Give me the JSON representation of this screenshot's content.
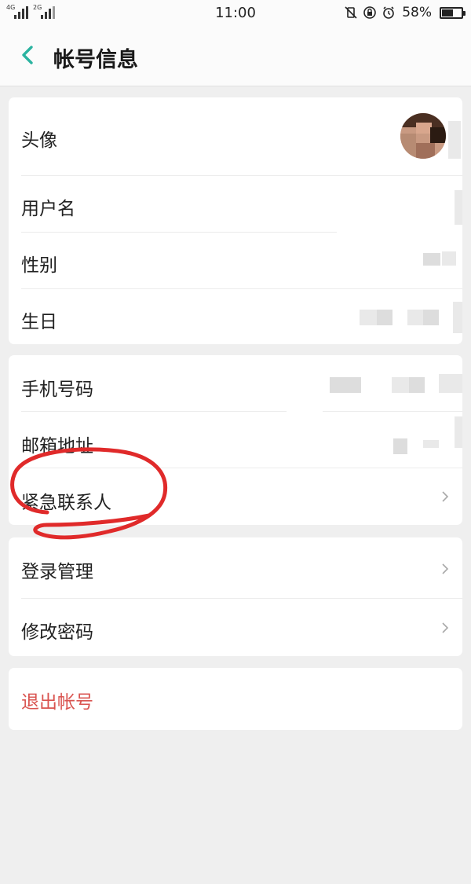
{
  "status_bar": {
    "network_1": "4G",
    "network_2": "2G",
    "time": "11:00",
    "battery_percent": "58%",
    "battery_level": 0.58,
    "icons": [
      "mute-vibrate-icon",
      "rotation-lock-icon",
      "alarm-icon",
      "battery-icon"
    ]
  },
  "header": {
    "title": "帐号信息",
    "back_icon": "chevron-left-icon",
    "accent_color": "#2bb3a0"
  },
  "profile_card": {
    "avatar_label": "头像",
    "username_label": "用户名",
    "gender_label": "性别",
    "birthday_label": "生日"
  },
  "contact_card": {
    "phone_label": "手机号码",
    "email_label": "邮箱地址",
    "emergency_label": "紧急联系人"
  },
  "security_card": {
    "login_label": "登录管理",
    "password_label": "修改密码"
  },
  "logout_card": {
    "logout_label": "退出帐号",
    "logout_color": "#d9534f"
  },
  "annotation_color": "#e02a2a"
}
